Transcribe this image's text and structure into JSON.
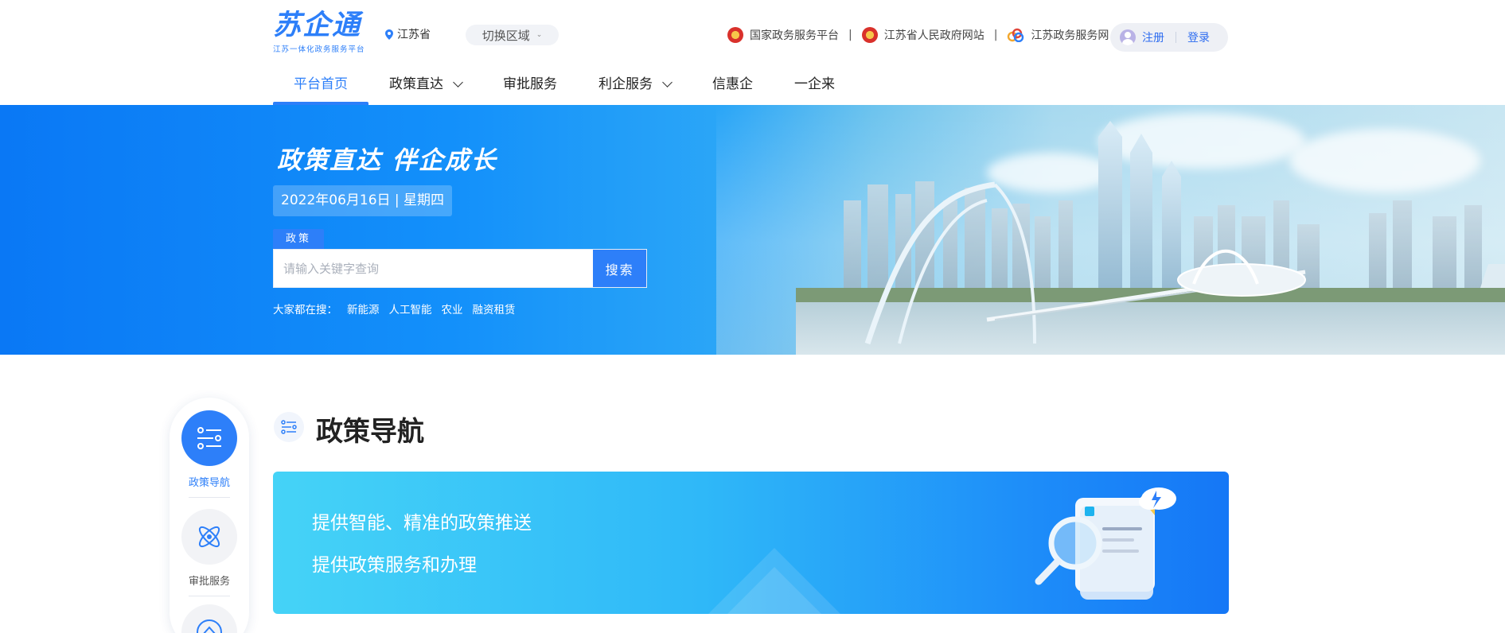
{
  "header": {
    "logo_text": "苏企通",
    "logo_sub": "江苏一体化政务服务平台",
    "location": "江苏省",
    "region_button": "切换区域",
    "links": [
      {
        "label": "国家政务服务平台",
        "icon": "national-emblem-icon"
      },
      {
        "label": "江苏省人民政府网站",
        "icon": "national-emblem-icon"
      },
      {
        "label": "江苏政务服务网",
        "icon": "jiangsu-gov-logo-icon"
      }
    ],
    "register": "注册",
    "login": "登录"
  },
  "nav": {
    "items": [
      {
        "label": "平台首页",
        "active": true,
        "dropdown": false
      },
      {
        "label": "政策直达",
        "active": false,
        "dropdown": true
      },
      {
        "label": "审批服务",
        "active": false,
        "dropdown": false
      },
      {
        "label": "利企服务",
        "active": false,
        "dropdown": true
      },
      {
        "label": "信惠企",
        "active": false,
        "dropdown": false
      },
      {
        "label": "一企来",
        "active": false,
        "dropdown": false
      }
    ]
  },
  "banner": {
    "slogan": "政策直达  伴企成长",
    "date": "2022年06月16日 | 星期四",
    "search_tab": "政策",
    "search_placeholder": "请输入关键字查询",
    "search_button": "搜索",
    "hot_label": "大家都在搜：",
    "hot_items": [
      "新能源",
      "人工智能",
      "农业",
      "融资租赁"
    ]
  },
  "sidenav": {
    "items": [
      {
        "label": "政策导航",
        "icon": "sliders-icon",
        "active": true
      },
      {
        "label": "审批服务",
        "icon": "atom-icon",
        "active": false
      },
      {
        "label": "",
        "icon": "house-icon",
        "active": false
      }
    ]
  },
  "section": {
    "title": "政策导航",
    "card_line1": "提供智能、精准的政策推送",
    "card_line2": "提供政策服务和办理"
  },
  "colors": {
    "brand_blue": "#2d7ff9",
    "banner_start": "#0a78f5",
    "card_start": "#45d3f7",
    "card_end": "#1577f6"
  }
}
